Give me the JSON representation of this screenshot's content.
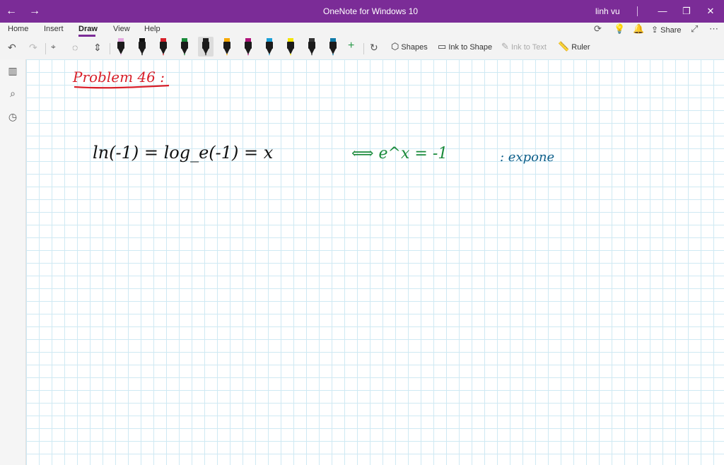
{
  "window": {
    "title": "OneNote for Windows 10",
    "user": "linh vu",
    "nav_back": "←",
    "nav_forward": "→",
    "minimize": "—",
    "restore": "❐",
    "close": "✕"
  },
  "ribbon": {
    "tabs": [
      {
        "label": "Home"
      },
      {
        "label": "Insert"
      },
      {
        "label": "Draw"
      },
      {
        "label": "View"
      },
      {
        "label": "Help"
      }
    ],
    "active_tab": "Draw",
    "share_label": "Share"
  },
  "toolbar": {
    "shapes_label": "Shapes",
    "ink_to_shape_label": "Ink to Shape",
    "ink_to_text_label": "Ink to Text",
    "ruler_label": "Ruler",
    "pen_colors": [
      "#e4a8e0",
      "#111111",
      "#d8202a",
      "#1a8a3a",
      "#1e1e1e",
      "#f6a800",
      "#b0147a",
      "#1aa0d8",
      "#f3e500",
      "#333333",
      "#0e7aa8"
    ]
  },
  "accent_color": "#7b2c97",
  "note": {
    "ink_heading": "Problem 46 :",
    "ink_equation": "ln(-1) = log_e(-1) = x",
    "ink_equivalence": "⟺ e^x = -1",
    "ink_comment": ": expone"
  }
}
